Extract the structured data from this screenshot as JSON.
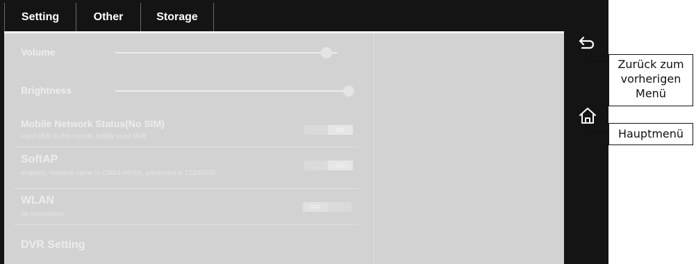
{
  "tabs": [
    {
      "label": "Setting"
    },
    {
      "label": "Other"
    },
    {
      "label": "Storage"
    }
  ],
  "settings": {
    "volume": {
      "label": "Volume",
      "level": 0.95
    },
    "brightness": {
      "label": "Brightness",
      "level": 1.0
    },
    "mobile_network": {
      "title": "Mobile Network Status(No SIM)",
      "subtitle": "used 0KB in this month, totally used 0KB",
      "toggle": "ON"
    },
    "softap": {
      "title": "SoftAP",
      "subtitle": "enabled, network name is CM84-HEKN, password is 12345678",
      "toggle": "ON"
    },
    "wlan": {
      "title": "WLAN",
      "subtitle": "no connection",
      "toggle": "OFF"
    },
    "dvr": {
      "title": "DVR Setting"
    }
  },
  "callouts": {
    "back": "Zurück zum vorherigen Menü",
    "home": "Hauptmenü"
  },
  "icons": {
    "back": "back-arrow-icon",
    "home": "home-icon"
  }
}
